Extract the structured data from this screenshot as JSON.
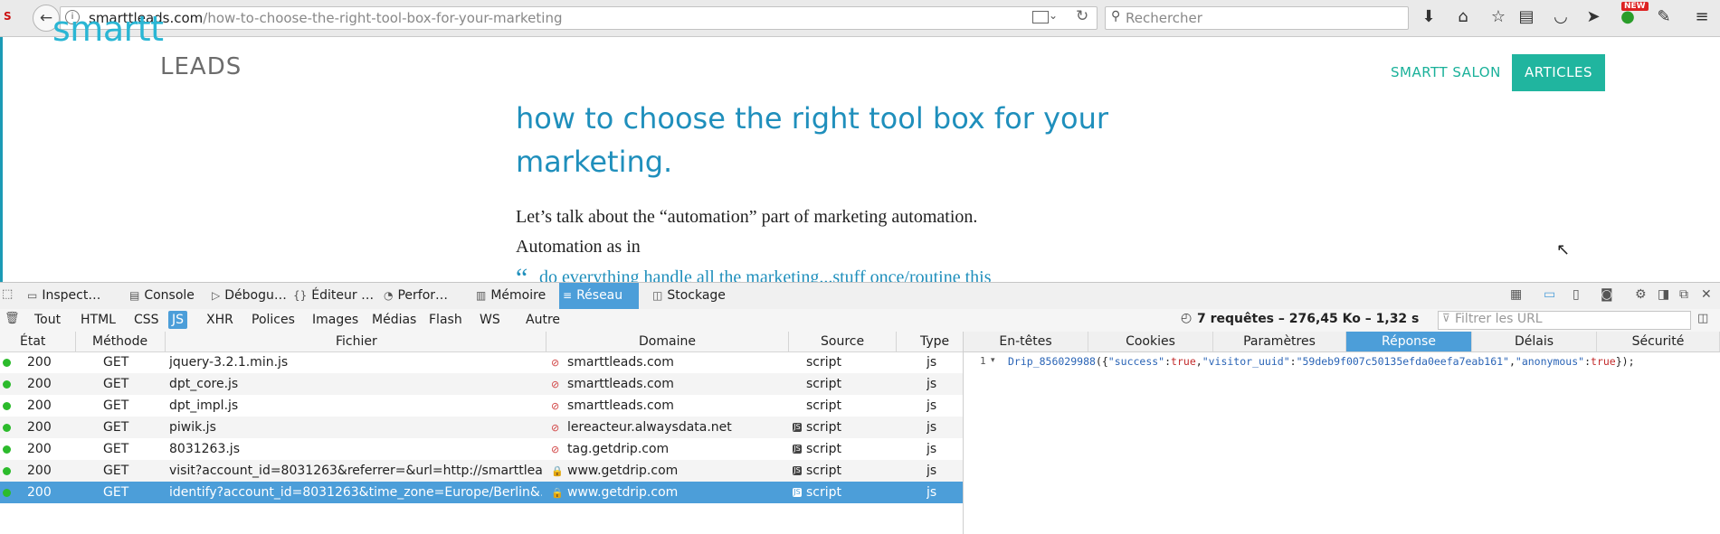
{
  "browser": {
    "url_domain": "smarttleads.com",
    "url_path": "/how-to-choose-the-right-tool-box-for-your-marketing",
    "search_placeholder": "Rechercher",
    "new_badge": "NEW"
  },
  "page": {
    "logo_part1": "smartt",
    "logo_part2": "LEADS",
    "nav_salon": "SMARTT SALON",
    "nav_articles": "ARTICLES",
    "title": "how to choose the right tool box for your marketing.",
    "paragraph_line1": "Let’s talk about the “automation” part of marketing automation.",
    "paragraph_line2": "Automation as in",
    "quote_glyph": "“",
    "quote_partial": "do everything handle all the marketing...stuff once/routine this"
  },
  "devtools": {
    "tabs": [
      {
        "label": "Inspect…",
        "icon": "▭"
      },
      {
        "label": "Console",
        "icon": "▤"
      },
      {
        "label": "Débogu…",
        "icon": "▷"
      },
      {
        "label": "Éditeur …",
        "icon": "{}"
      },
      {
        "label": "Perfor…",
        "icon": "◔"
      },
      {
        "label": "Mémoire",
        "icon": "▥"
      },
      {
        "label": "Réseau",
        "icon": "≡"
      },
      {
        "label": "Stockage",
        "icon": "◫"
      }
    ],
    "filters": [
      "Tout",
      "HTML",
      "CSS",
      "JS",
      "XHR",
      "Polices",
      "Images",
      "Médias",
      "Flash",
      "WS",
      "Autre"
    ],
    "active_filter": "JS",
    "summary": "7 requêtes – 276,45 Ko – 1,32 s",
    "url_filter_placeholder": "Filtrer les URL",
    "columns": {
      "state": "État",
      "method": "Méthode",
      "file": "Fichier",
      "domain": "Domaine",
      "source": "Source",
      "type": "Type"
    },
    "requests": [
      {
        "status": "200",
        "method": "GET",
        "file": "jquery-3.2.1.min.js",
        "domain": "smarttleads.com",
        "source": "script",
        "type": "js",
        "secure": "insecure",
        "js_badge": false
      },
      {
        "status": "200",
        "method": "GET",
        "file": "dpt_core.js",
        "domain": "smarttleads.com",
        "source": "script",
        "type": "js",
        "secure": "insecure",
        "js_badge": false
      },
      {
        "status": "200",
        "method": "GET",
        "file": "dpt_impl.js",
        "domain": "smarttleads.com",
        "source": "script",
        "type": "js",
        "secure": "insecure",
        "js_badge": false
      },
      {
        "status": "200",
        "method": "GET",
        "file": "piwik.js",
        "domain": "lereacteur.alwaysdata.net",
        "source": "script",
        "type": "js",
        "secure": "insecure",
        "js_badge": true
      },
      {
        "status": "200",
        "method": "GET",
        "file": "8031263.js",
        "domain": "tag.getdrip.com",
        "source": "script",
        "type": "js",
        "secure": "insecure",
        "js_badge": true
      },
      {
        "status": "200",
        "method": "GET",
        "file": "visit?account_id=8031263&referrer=&url=http://smarttlea…",
        "domain": "www.getdrip.com",
        "source": "script",
        "type": "js",
        "secure": "secure",
        "js_badge": true
      },
      {
        "status": "200",
        "method": "GET",
        "file": "identify?account_id=8031263&time_zone=Europe/Berlin&…",
        "domain": "www.getdrip.com",
        "source": "script",
        "type": "js",
        "secure": "secure",
        "js_badge": true
      }
    ],
    "selected_row": 6,
    "side_tabs": [
      "En-têtes",
      "Cookies",
      "Paramètres",
      "Réponse",
      "Délais",
      "Sécurité"
    ],
    "active_side_tab": "Réponse",
    "response": {
      "line_number": "1",
      "fn": "Drip_856029988",
      "open": "({",
      "k1": "\"success\"",
      "v1": "true",
      "k2": "\"visitor_uuid\"",
      "v2": "\"59deb9f007c50135efda0eefa7eab161\"",
      "k3": "\"anonymous\"",
      "v3": "true",
      "close": "});"
    }
  },
  "colors": {
    "accent": "#4c9ed9",
    "brand_teal": "#20b59f",
    "title_blue": "#1f8fbc",
    "status_ok": "#2cbb2c"
  }
}
